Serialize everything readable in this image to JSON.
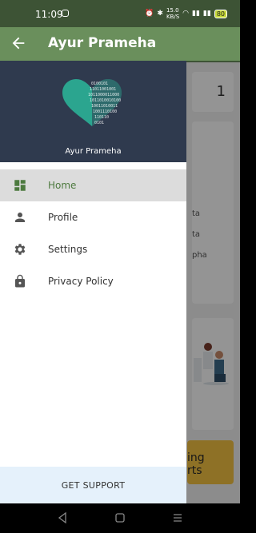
{
  "status_bar": {
    "time": "11:09",
    "net_speed_top": "15.0",
    "net_speed_unit": "KB/S",
    "battery": "80"
  },
  "toolbar": {
    "title": "Ayur Prameha"
  },
  "drawer": {
    "brand": "Ayur Prameha",
    "items": [
      {
        "label": "Home",
        "icon": "dashboard-icon"
      },
      {
        "label": "Profile",
        "icon": "person-icon"
      },
      {
        "label": "Settings",
        "icon": "gear-icon"
      },
      {
        "label": "Privacy Policy",
        "icon": "lock-icon"
      }
    ],
    "support_label": "GET SUPPORT"
  },
  "background": {
    "card_number": "1",
    "lines": [
      "ta",
      "ta",
      "pha"
    ],
    "banner_text": [
      "ing",
      "rts"
    ]
  },
  "colors": {
    "toolbar": "#6a8f5c",
    "header": "#2f3a4e",
    "accent": "#4d7a3f",
    "support_bg": "#e5f1fb"
  }
}
